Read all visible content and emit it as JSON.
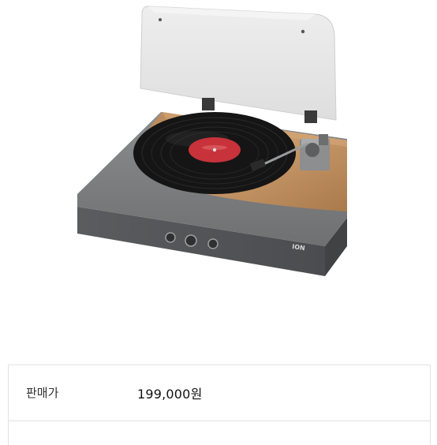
{
  "product": {
    "image_alt": "turntable-product-image",
    "brand_mark": "ION"
  },
  "price_table": {
    "rows": [
      {
        "label": "판매가",
        "value": "199,000원"
      }
    ]
  }
}
